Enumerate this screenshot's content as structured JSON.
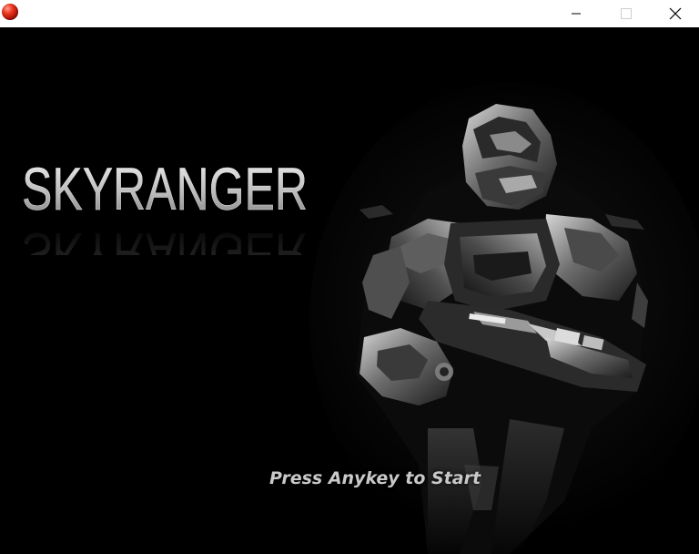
{
  "window": {
    "app_icon": "red-sphere-icon",
    "controls": {
      "minimize": "minimize-icon",
      "maximize": "maximize-icon",
      "close": "close-icon"
    }
  },
  "game": {
    "logo_text": "SKYRANGER",
    "prompt": "Press Anykey to Start",
    "colors": {
      "background": "#000000",
      "logo": "#d6d6d6",
      "prompt": "#c9c9c9"
    }
  }
}
